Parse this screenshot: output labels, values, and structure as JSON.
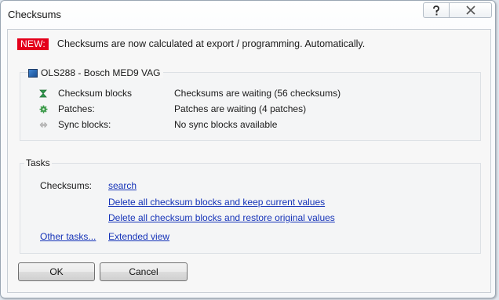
{
  "window": {
    "title": "Checksums"
  },
  "notice": {
    "badge": "NEW:",
    "text": "Checksums are now calculated at export / programming. Automatically."
  },
  "project": {
    "title": "OLS288 - Bosch MED9 VAG",
    "rows": [
      {
        "icon": "hourglass-icon",
        "label": "Checksum blocks",
        "value": "Checksums are waiting (56 checksums)"
      },
      {
        "icon": "gear-icon",
        "label": "Patches:",
        "value": "Patches are waiting (4 patches)"
      },
      {
        "icon": "sync-arrows-icon",
        "label": "Sync blocks:",
        "value": "No sync blocks available"
      }
    ]
  },
  "tasks": {
    "title": "Tasks",
    "checksums_label": "Checksums:",
    "search_link": "search",
    "delete_keep_link": "Delete all checksum blocks and keep current values",
    "delete_restore_link": "Delete all checksum blocks and restore original values",
    "other_tasks_link": "Other tasks...",
    "extended_view_link": "Extended view"
  },
  "buttons": {
    "ok": "OK",
    "cancel": "Cancel"
  },
  "colors": {
    "new_badge": "#e4001b",
    "link": "#1533b8",
    "hourglass_icon": "#2f9a4c",
    "gear_icon": "#3c9a4a",
    "sync_icon": "#a8a8a8"
  }
}
